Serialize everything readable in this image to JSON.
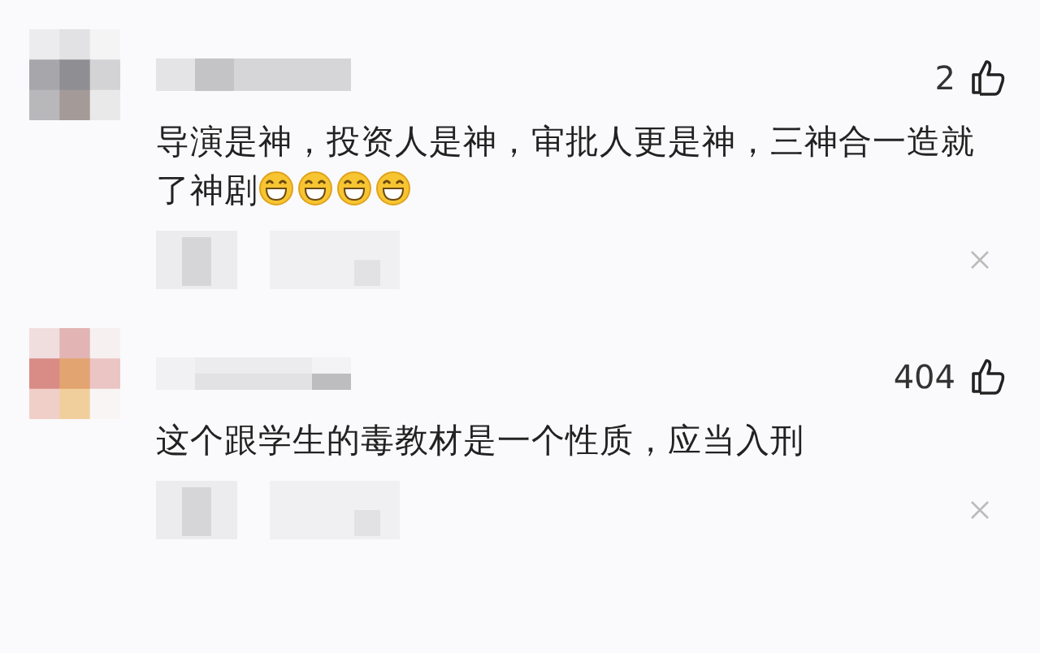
{
  "comments": [
    {
      "likes": "2",
      "text": "导演是神，投资人是神，审批人更是神，三神合一造就了神剧",
      "emojis": [
        {
          "kind": "grin"
        },
        {
          "kind": "grin"
        },
        {
          "kind": "grin"
        },
        {
          "kind": "grin"
        }
      ]
    },
    {
      "likes": "404",
      "text": "这个跟学生的毒教材是一个性质，应当入刑"
    }
  ]
}
